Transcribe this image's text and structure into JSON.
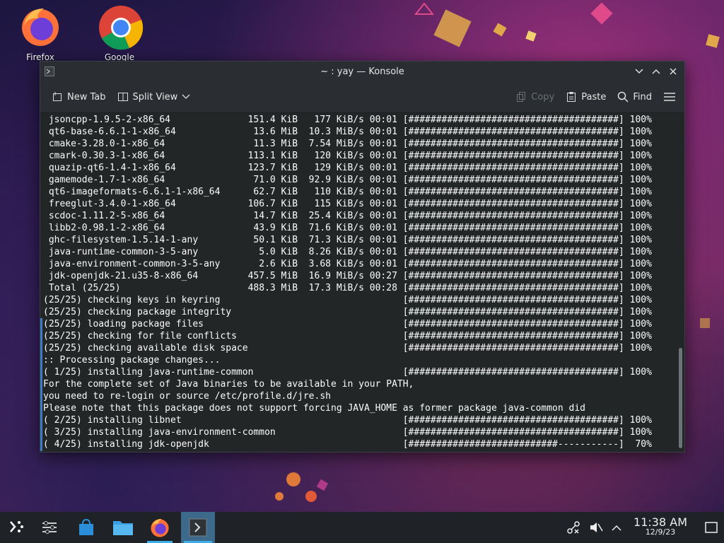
{
  "desktop": {
    "icons": [
      {
        "label": "Firefox",
        "icon": "firefox-icon"
      },
      {
        "label": "Google Chrome",
        "icon": "chrome-icon"
      }
    ]
  },
  "window": {
    "title": "~ : yay — Konsole",
    "toolbar": {
      "new_tab": "New Tab",
      "split_view": "Split View",
      "copy": "Copy",
      "paste": "Paste",
      "find": "Find"
    },
    "terminal_lines": [
      " jsoncpp-1.9.5-2-x86_64              151.4 KiB   177 KiB/s 00:01 [######################################] 100%",
      " qt6-base-6.6.1-1-x86_64              13.6 MiB  10.3 MiB/s 00:01 [######################################] 100%",
      " cmake-3.28.0-1-x86_64                11.3 MiB  7.54 MiB/s 00:01 [######################################] 100%",
      " cmark-0.30.3-1-x86_64               113.1 KiB   120 KiB/s 00:01 [######################################] 100%",
      " quazip-qt6-1.4-1-x86_64             123.7 KiB   129 KiB/s 00:01 [######################################] 100%",
      " gamemode-1.7-1-x86_64                71.0 KiB  92.9 KiB/s 00:01 [######################################] 100%",
      " qt6-imageformats-6.6.1-1-x86_64      62.7 KiB   110 KiB/s 00:01 [######################################] 100%",
      " freeglut-3.4.0-1-x86_64             106.7 KiB   115 KiB/s 00:01 [######################################] 100%",
      " scdoc-1.11.2-5-x86_64                14.7 KiB  25.4 KiB/s 00:01 [######################################] 100%",
      " libb2-0.98.1-2-x86_64                43.9 KiB  71.6 KiB/s 00:01 [######################################] 100%",
      " ghc-filesystem-1.5.14-1-any          50.1 KiB  71.3 KiB/s 00:01 [######################################] 100%",
      " java-runtime-common-3-5-any           5.0 KiB  8.26 KiB/s 00:01 [######################################] 100%",
      " java-environment-common-3-5-any       2.6 KiB  3.68 KiB/s 00:01 [######################################] 100%",
      " jdk-openjdk-21.u35-8-x86_64         457.5 MiB  16.9 MiB/s 00:27 [######################################] 100%",
      " Total (25/25)                       488.3 MiB  17.3 MiB/s 00:28 [######################################] 100%",
      "(25/25) checking keys in keyring                                 [######################################] 100%",
      "(25/25) checking package integrity                               [######################################] 100%",
      "(25/25) loading package files                                    [######################################] 100%",
      "(25/25) checking for file conflicts                              [######################################] 100%",
      "(25/25) checking available disk space                            [######################################] 100%",
      ":: Processing package changes...",
      "( 1/25) installing java-runtime-common                           [######################################] 100%",
      "For the complete set of Java binaries to be available in your PATH,",
      "you need to re-login or source /etc/profile.d/jre.sh",
      "Please note that this package does not support forcing JAVA_HOME as former package java-common did",
      "( 2/25) installing libnet                                        [######################################] 100%",
      "( 3/25) installing java-environment-common                       [######################################] 100%",
      "( 4/25) installing jdk-openjdk                                   [###########################-----------]  70%"
    ]
  },
  "taskbar": {
    "clock_time": "11:38 AM",
    "clock_date": "12/9/23"
  },
  "colors": {
    "accent": "#3daee9",
    "terminal_bg": "#232627",
    "window_bg": "#2a2e32"
  }
}
